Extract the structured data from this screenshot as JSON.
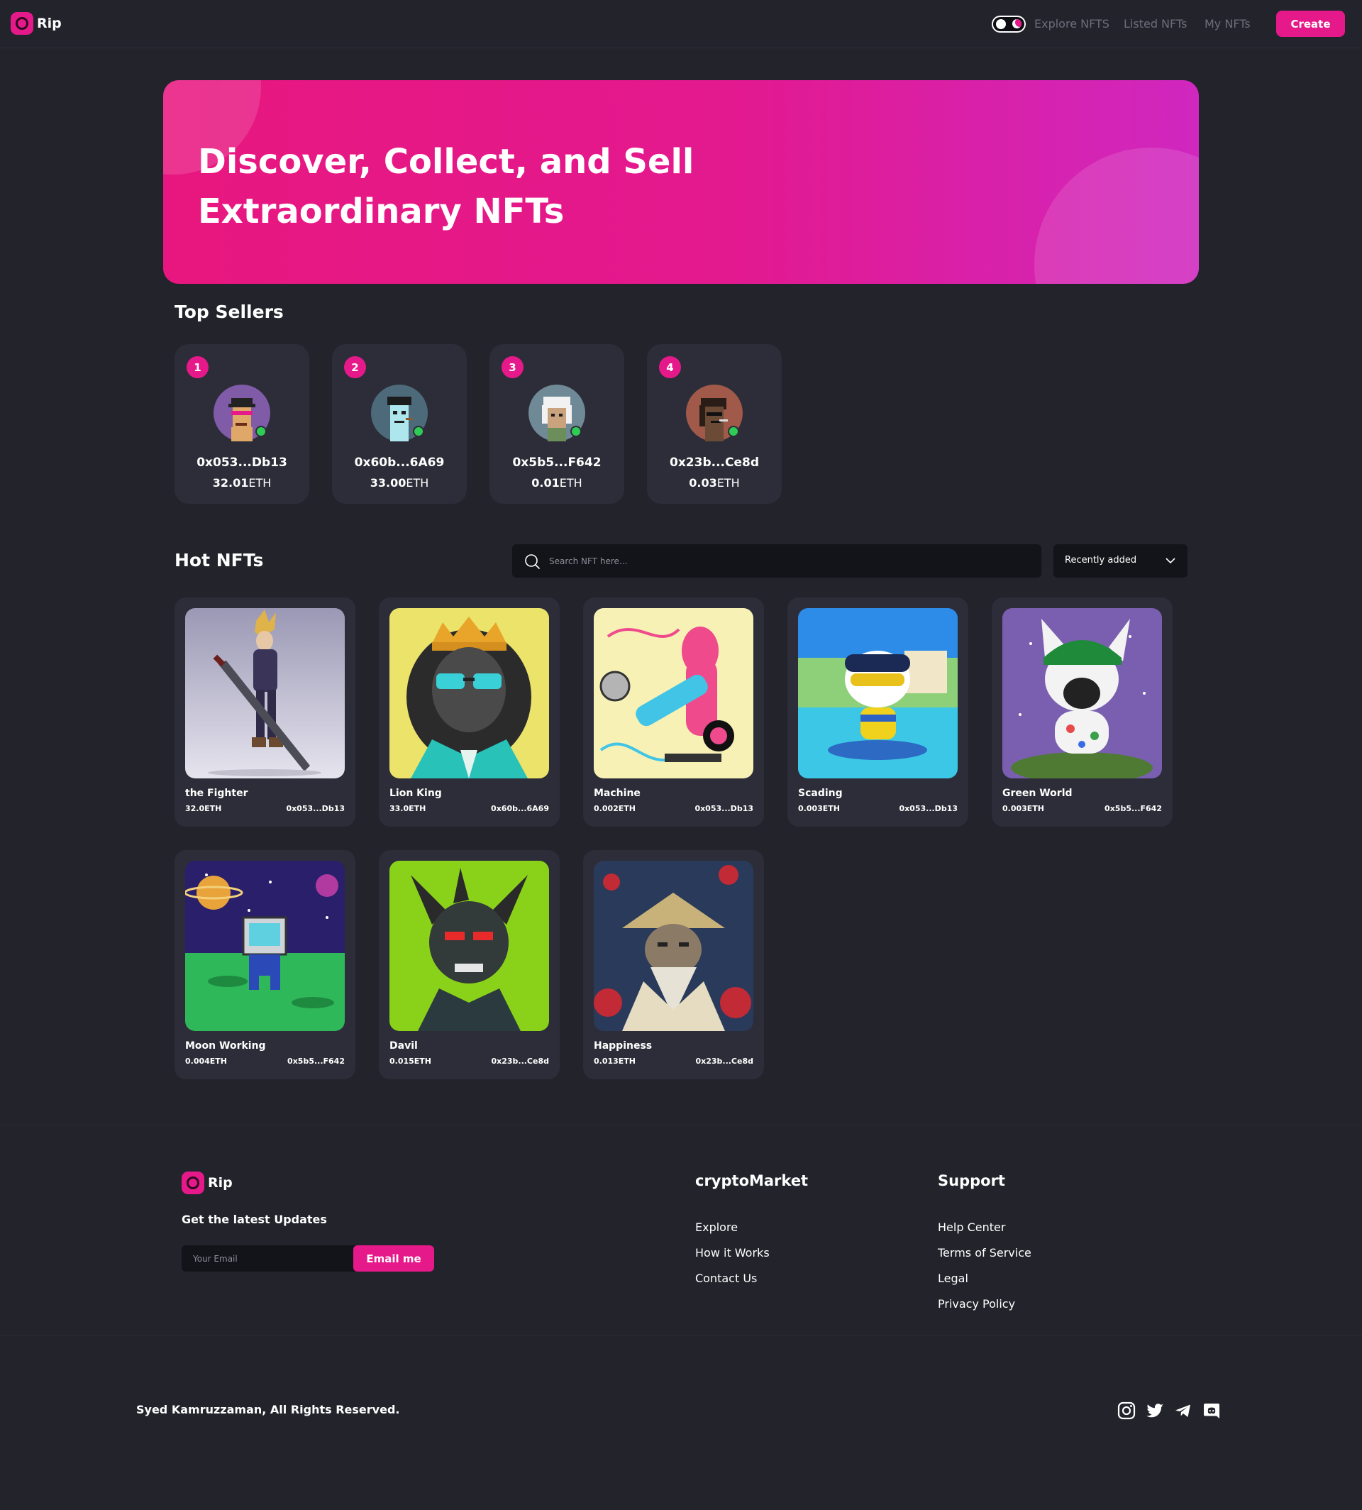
{
  "brand": {
    "name": "Rip"
  },
  "header": {
    "nav": [
      "Explore NFTS",
      "Listed NFTs",
      "My NFTs"
    ],
    "create_label": "Create"
  },
  "hero": {
    "title_line1": "Discover, Collect, and Sell",
    "title_line2": "Extraordinary NFTs"
  },
  "top_sellers": {
    "title": "Top Sellers",
    "items": [
      {
        "rank": "1",
        "address": "0x053...Db13",
        "amount": "32.01",
        "unit": "ETH"
      },
      {
        "rank": "2",
        "address": "0x60b...6A69",
        "amount": "33.00",
        "unit": "ETH"
      },
      {
        "rank": "3",
        "address": "0x5b5...F642",
        "amount": "0.01",
        "unit": "ETH"
      },
      {
        "rank": "4",
        "address": "0x23b...Ce8d",
        "amount": "0.03",
        "unit": "ETH"
      }
    ]
  },
  "hot_nfts": {
    "title": "Hot NFTs",
    "search_placeholder": "Search NFT here...",
    "sort_selected": "Recently added",
    "items": [
      {
        "name": "the Fighter",
        "price": "32.0ETH",
        "owner": "0x053...Db13"
      },
      {
        "name": "Lion King",
        "price": "33.0ETH",
        "owner": "0x60b...6A69"
      },
      {
        "name": "Machine",
        "price": "0.002ETH",
        "owner": "0x053...Db13"
      },
      {
        "name": "Scading",
        "price": "0.003ETH",
        "owner": "0x053...Db13"
      },
      {
        "name": "Green World",
        "price": "0.003ETH",
        "owner": "0x5b5...F642"
      },
      {
        "name": "Moon Working",
        "price": "0.004ETH",
        "owner": "0x5b5...F642"
      },
      {
        "name": "Davil",
        "price": "0.015ETH",
        "owner": "0x23b...Ce8d"
      },
      {
        "name": "Happiness",
        "price": "0.013ETH",
        "owner": "0x23b...Ce8d"
      }
    ]
  },
  "footer": {
    "tagline": "Get the latest Updates",
    "email_placeholder": "Your Email",
    "email_button": "Email me",
    "columns": [
      {
        "title": "cryptoMarket",
        "links": [
          "Explore",
          "How it Works",
          "Contact Us"
        ]
      },
      {
        "title": "Support",
        "links": [
          "Help Center",
          "Terms of Service",
          "Legal",
          "Privacy Policy"
        ]
      }
    ],
    "copyright": "Syed Kamruzzaman, All Rights Reserved.",
    "social_icons": [
      "instagram-icon",
      "twitter-icon",
      "telegram-icon",
      "discord-icon"
    ]
  },
  "colors": {
    "accent": "#e6198a",
    "background": "#22232b",
    "card": "#2c2d38",
    "input": "#131419",
    "verified": "#2ecc55"
  }
}
